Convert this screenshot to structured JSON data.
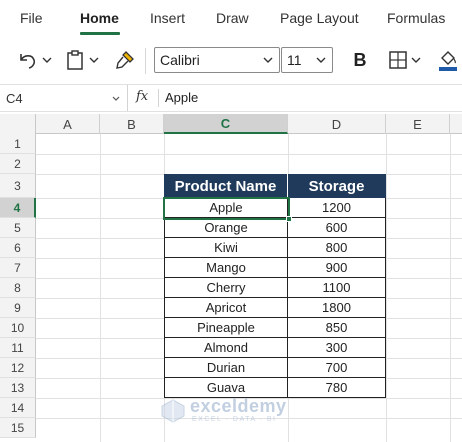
{
  "ribbon": {
    "tabs": [
      {
        "label": "File",
        "active": false
      },
      {
        "label": "Home",
        "active": true
      },
      {
        "label": "Insert",
        "active": false
      },
      {
        "label": "Draw",
        "active": false
      },
      {
        "label": "Page Layout",
        "active": false
      },
      {
        "label": "Formulas",
        "active": false
      }
    ]
  },
  "toolbar": {
    "font_name": "Calibri",
    "font_size": "11",
    "bold_label": "B",
    "icons": [
      "undo-icon",
      "paste-icon",
      "format-painter-icon",
      "borders-icon",
      "fill-color-icon"
    ]
  },
  "formula_bar": {
    "name_box": "C4",
    "fx_label": "fx",
    "content": "Apple"
  },
  "grid": {
    "columns": [
      "A",
      "B",
      "C",
      "D",
      "E"
    ],
    "selected_column": "C",
    "rows": [
      "1",
      "2",
      "3",
      "4",
      "5",
      "6",
      "7",
      "8",
      "9",
      "10",
      "11",
      "12",
      "13",
      "14",
      "15"
    ],
    "selected_row": "4"
  },
  "table": {
    "headers": [
      "Product Name",
      "Storage"
    ],
    "rows": [
      [
        "Apple",
        "1200"
      ],
      [
        "Orange",
        "600"
      ],
      [
        "Kiwi",
        "800"
      ],
      [
        "Mango",
        "900"
      ],
      [
        "Cherry",
        "1100"
      ],
      [
        "Apricot",
        "1800"
      ],
      [
        "Pineapple",
        "850"
      ],
      [
        "Almond",
        "300"
      ],
      [
        "Durian",
        "700"
      ],
      [
        "Guava",
        "780"
      ]
    ]
  },
  "watermark": {
    "brand": "exceldemy",
    "tagline": "EXCEL · DATA · BI"
  },
  "colors": {
    "accent": "#217346",
    "header_fill": "#1f3a5a"
  }
}
